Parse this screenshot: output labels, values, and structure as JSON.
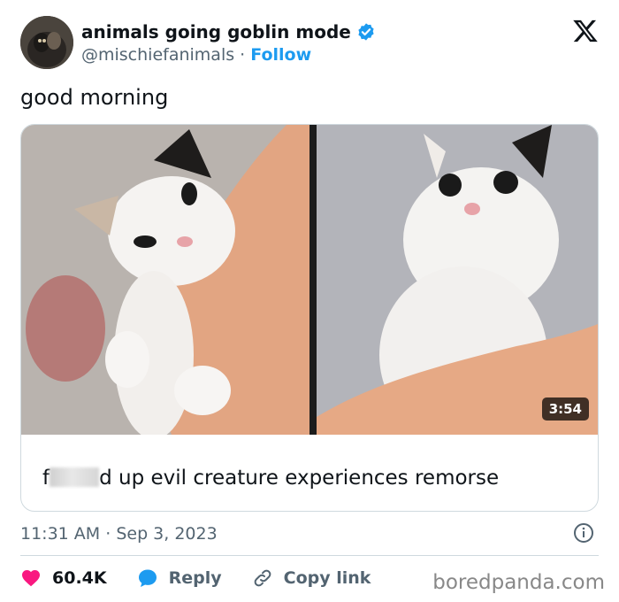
{
  "author": {
    "display_name": "animals going goblin mode",
    "handle": "@mischiefanimals",
    "separator": "·",
    "follow_label": "Follow",
    "verified_color": "#1d9bf0"
  },
  "platform_icon": "x-logo-icon",
  "tweet": {
    "text": "good morning"
  },
  "media": {
    "type": "video",
    "duration": "3:54",
    "caption_prefix": "f",
    "caption_suffix": "d up evil creature experiences remorse"
  },
  "meta": {
    "time": "11:31 AM",
    "separator": "·",
    "date": "Sep 3, 2023"
  },
  "actions": {
    "likes": "60.4K",
    "like_color": "#f91880",
    "reply_label": "Reply",
    "reply_color": "#1d9bf0",
    "copy_label": "Copy link"
  },
  "watermark": "boredpanda.com"
}
